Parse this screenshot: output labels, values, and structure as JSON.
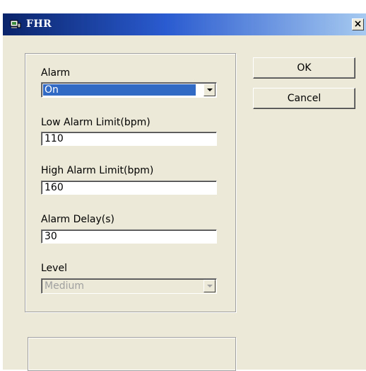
{
  "window": {
    "title": "FHR",
    "close_label": "×",
    "titlebar_colors": [
      "#0a246a",
      "#a6caf0"
    ]
  },
  "form": {
    "alarm": {
      "label": "Alarm",
      "value": "On",
      "options": [
        "On"
      ]
    },
    "low_limit": {
      "label": "Low Alarm Limit(bpm)",
      "value": "110"
    },
    "high_limit": {
      "label": "High Alarm Limit(bpm)",
      "value": "160"
    },
    "delay": {
      "label": "Alarm Delay(s)",
      "value": "30"
    },
    "level": {
      "label": "Level",
      "value": "Medium",
      "enabled": false
    }
  },
  "buttons": {
    "ok_label": "OK",
    "cancel_label": "Cancel"
  },
  "status": {
    "text": ""
  },
  "icons": {
    "window_icon": "monitor-icon",
    "close_icon": "close-icon",
    "dropdown_icon": "chevron-down-icon"
  }
}
